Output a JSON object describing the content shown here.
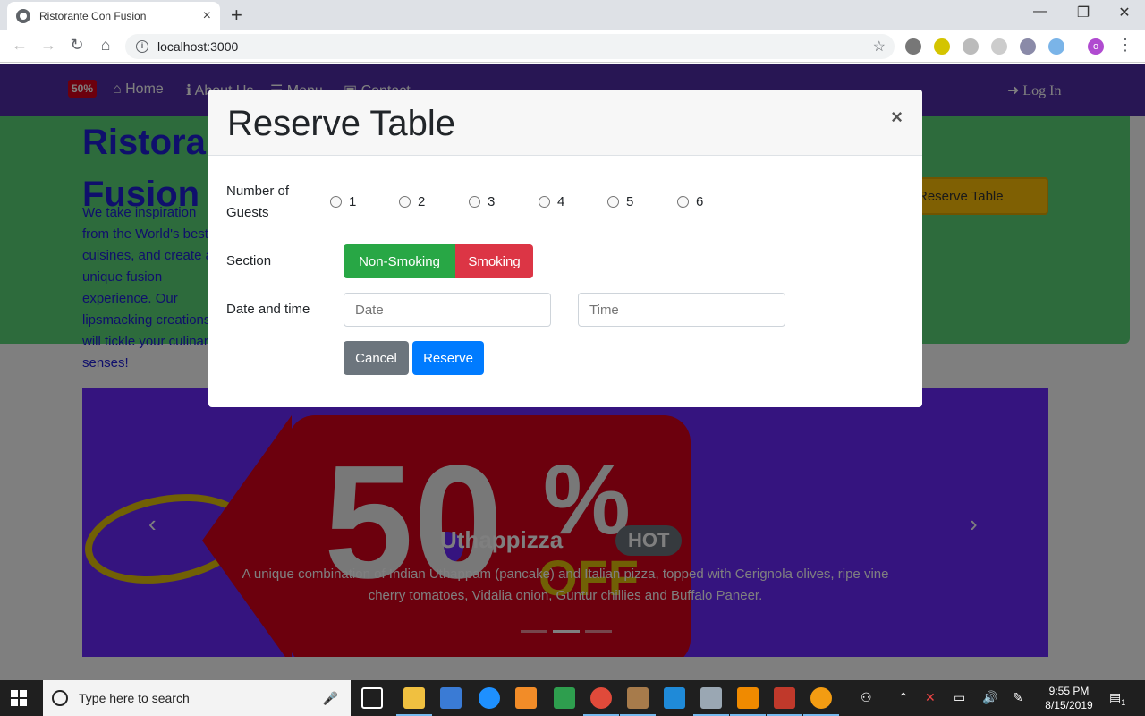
{
  "browser": {
    "tab_title": "Ristorante Con Fusion",
    "tab_close": "×",
    "new_tab": "+",
    "url": "localhost:3000",
    "info_glyph": "i",
    "star_glyph": "☆",
    "profile_initial": "o",
    "minimize": "—",
    "maximize": "❐",
    "close": "✕",
    "back": "←",
    "forward": "→",
    "reload": "↻",
    "home": "⌂",
    "menu": "⋮"
  },
  "navbar": {
    "logo_text": "50%",
    "items": [
      {
        "label": "Home",
        "icon": "home-icon"
      },
      {
        "label": "About Us",
        "icon": "info-icon"
      },
      {
        "label": "Menu",
        "icon": "list-icon"
      },
      {
        "label": "Contact",
        "icon": "address-card-icon"
      }
    ],
    "login": "Log In"
  },
  "jumbotron": {
    "title_line1": "Ristorante con",
    "title_line2": "Fusion",
    "text": "We take inspiration from the World's best cuisines, and create a unique fusion experience. Our lipsmacking creations will tickle your culinary senses!",
    "reserve_button_partial": "Reserve Table"
  },
  "carousel": {
    "promo_number": "50",
    "promo_percent": "%",
    "promo_off": "OFF",
    "caption_title": "Uthappizza",
    "badge": "HOT",
    "caption_text": "A unique combination of Indian Uthappam (pancake) and Italian pizza, topped with Cerignola olives, ripe vine cherry tomatoes, Vidalia onion, Guntur chillies and Buffalo Paneer.",
    "prev": "‹",
    "next": "›",
    "active_indicator": 1
  },
  "modal": {
    "title": "Reserve Table",
    "close": "×",
    "guests_label_1": "Number of",
    "guests_label_2": "Guests",
    "guest_options": [
      "1",
      "2",
      "3",
      "4",
      "5",
      "6"
    ],
    "section_label": "Section",
    "non_smoking": "Non-Smoking",
    "smoking": "Smoking",
    "datetime_label": "Date and time",
    "date_placeholder": "Date",
    "time_placeholder": "Time",
    "cancel": "Cancel",
    "reserve": "Reserve"
  },
  "taskbar": {
    "search_placeholder": "Type here to search",
    "time": "9:55 PM",
    "date": "8/15/2019",
    "notification_count": "1"
  },
  "colors": {
    "navbar": "#512da8",
    "jumbotron": "#5bd679",
    "success": "#28a745",
    "danger": "#dc3545",
    "secondary": "#6c757d",
    "primary": "#007bff"
  }
}
